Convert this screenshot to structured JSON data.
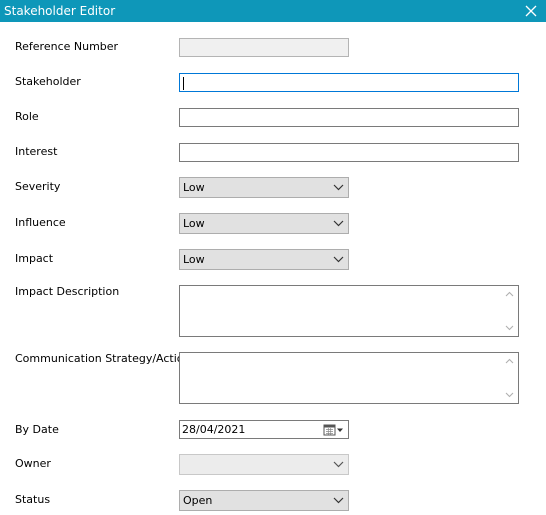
{
  "window": {
    "title": "Stakeholder Editor"
  },
  "labels": {
    "reference_number": "Reference Number",
    "stakeholder": "Stakeholder",
    "role": "Role",
    "interest": "Interest",
    "severity": "Severity",
    "influence": "Influence",
    "impact": "Impact",
    "impact_description": "Impact Description",
    "communication": "Communication Strategy/Actions",
    "by_date": "By Date",
    "owner": "Owner",
    "status": "Status"
  },
  "values": {
    "reference_number": "",
    "stakeholder": "",
    "role": "",
    "interest": "",
    "severity": "Low",
    "influence": "Low",
    "impact": "Low",
    "impact_description": "",
    "communication": "",
    "by_date": "28/04/2021",
    "owner": "",
    "status": "Open"
  },
  "icons": {
    "close": "close-icon",
    "dropdown": "chevron-down-icon",
    "calendar": "calendar-icon"
  },
  "colors": {
    "titlebar": "#0e97b9",
    "focus_border": "#0078d7"
  }
}
